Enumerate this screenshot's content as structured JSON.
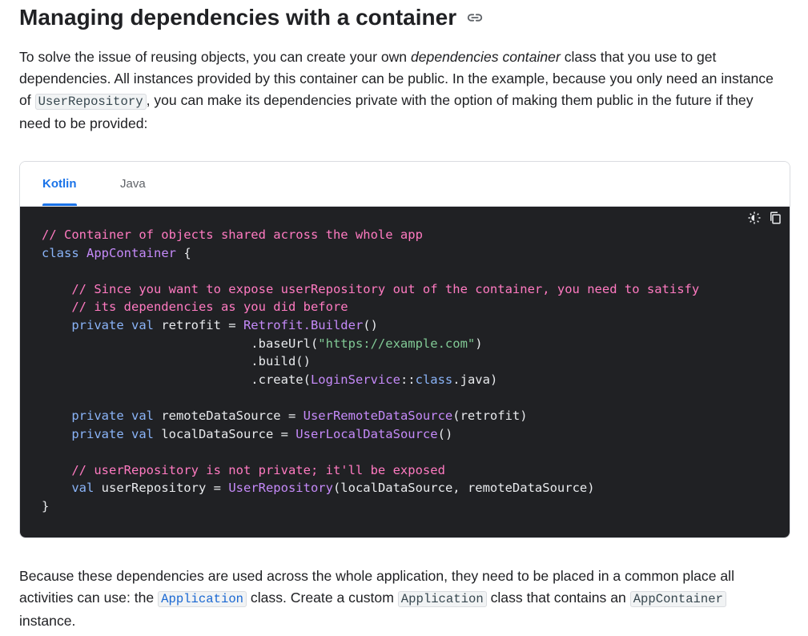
{
  "heading": "Managing dependencies with a container",
  "intro": {
    "p1": "To solve the issue of reusing objects, you can create your own ",
    "em": "dependencies container",
    "p2": " class that you use to get dependencies. All instances provided by this container can be public. In the example, because you only need an instance of ",
    "code": "UserRepository",
    "p3": ", you can make its dependencies private with the option of making them public in the future if they need to be provided:"
  },
  "tabs": [
    {
      "label": "Kotlin",
      "active": true
    },
    {
      "label": "Java",
      "active": false
    }
  ],
  "code_tools": [
    "theme-toggle-icon",
    "copy-icon"
  ],
  "code": {
    "l1": "// Container of objects shared across the whole app",
    "l2_kw": "class",
    "l2_name": "AppContainer",
    "l2_rest": " {",
    "l4": "    // Since you want to expose userRepository out of the container, you need to satisfy",
    "l5": "    // its dependencies as you did before",
    "l6_kw": "    private val",
    "l6_name": " retrofit = ",
    "l6_type": "Retrofit.Builder",
    "l6_rest": "()",
    "l7_a": "                            .baseUrl(",
    "l7_str": "\"https://example.com\"",
    "l7_b": ")",
    "l8": "                            .build()",
    "l9_a": "                            .create(",
    "l9_type": "LoginService",
    "l9_b": "::",
    "l9_kw": "class",
    "l9_c": ".java)",
    "l11_kw": "    private val",
    "l11_name": " remoteDataSource = ",
    "l11_type": "UserRemoteDataSource",
    "l11_rest": "(retrofit)",
    "l12_kw": "    private val",
    "l12_name": " localDataSource = ",
    "l12_type": "UserLocalDataSource",
    "l12_rest": "()",
    "l14": "    // userRepository is not private; it'll be exposed",
    "l15_kw": "    val",
    "l15_name": " userRepository = ",
    "l15_type": "UserRepository",
    "l15_rest": "(localDataSource, remoteDataSource)",
    "l16": "}"
  },
  "outro": {
    "p1": "Because these dependencies are used across the whole application, they need to be placed in a common place all activities can use: the ",
    "code1": "Application",
    "p2": " class. Create a custom ",
    "code2": "Application",
    "p3": " class that contains an ",
    "code3": "AppContainer",
    "p4": " instance."
  },
  "colors": {
    "accent": "#1a73e8",
    "code_bg": "#202124",
    "comment": "#ff7ac1",
    "keyword": "#8ab4f8",
    "type": "#c58af9",
    "string": "#81c995"
  }
}
